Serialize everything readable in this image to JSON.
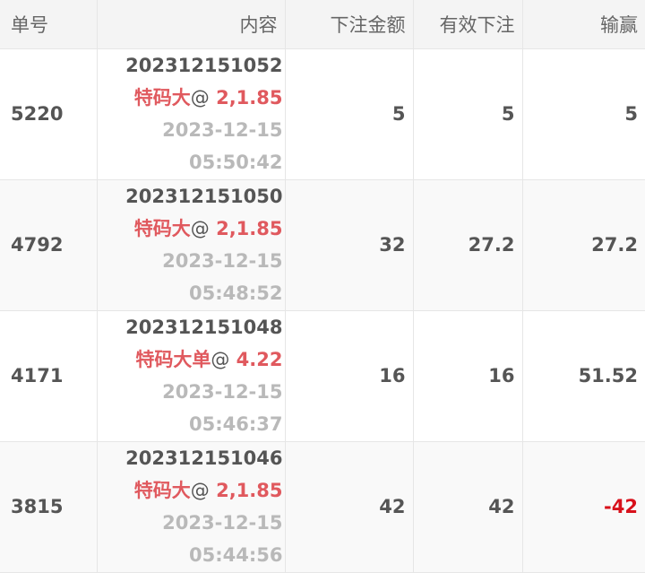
{
  "table": {
    "headers": [
      "单号",
      "内容",
      "下注金额",
      "有效下注",
      "输赢"
    ],
    "rows": [
      {
        "id": "5220",
        "order_no": "202312151052",
        "bet_type": "特码大",
        "at": "@",
        "odds": "2,1.85",
        "date": "2023-12-15",
        "time": "05:50:42",
        "amount": "5",
        "valid": "5",
        "result": "5"
      },
      {
        "id": "4792",
        "order_no": "202312151050",
        "bet_type": "特码大",
        "at": "@",
        "odds": "2,1.85",
        "date": "2023-12-15",
        "time": "05:48:52",
        "amount": "32",
        "valid": "27.2",
        "result": "27.2"
      },
      {
        "id": "4171",
        "order_no": "202312151048",
        "bet_type": "特码大单",
        "at": "@",
        "odds": "4.22",
        "date": "2023-12-15",
        "time": "05:46:37",
        "amount": "16",
        "valid": "16",
        "result": "51.52"
      },
      {
        "id": "3815",
        "order_no": "202312151046",
        "bet_type": "特码大",
        "at": "@",
        "odds": "2,1.85",
        "date": "2023-12-15",
        "time": "05:44:56",
        "amount": "42",
        "valid": "42",
        "result": "-42"
      }
    ]
  },
  "colors": {
    "accent_red": "#e0595e",
    "loss_red": "#d8111b",
    "header_bg": "#f4f4f4",
    "muted_text": "#b9b9b9"
  }
}
